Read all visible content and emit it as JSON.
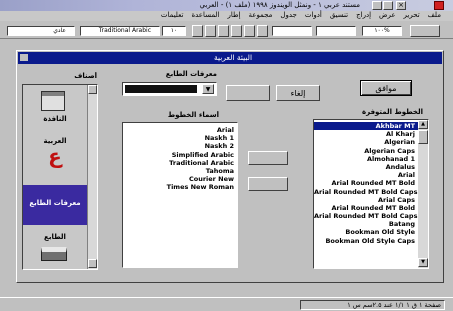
{
  "app": {
    "title": "مستند عربي ١ - ونمثل الويندوز ١٩٩٨ (ملف ١) - العربي",
    "menu": [
      "ملف",
      "تحرير",
      "عرض",
      "إدراج",
      "تنسيق",
      "أدوات",
      "جدول",
      "مجموعة",
      "إطار",
      "المساعدة",
      "تعليمات"
    ]
  },
  "toolbar": {
    "style_value": "عادي",
    "font_value": "Traditional Arabic",
    "size_value": "١٠",
    "zoom_value": "١٠٠%"
  },
  "dialog": {
    "title": "البيئة العربية",
    "sidebar_header": "أصناف",
    "sidebar_items": [
      {
        "label": "النافذة",
        "icon": "window-icon"
      },
      {
        "label": "العربية",
        "icon": "arabic-letter-icon",
        "glyph": "ع"
      },
      {
        "label": "معرفات الطابع",
        "icon": "charset-icon"
      },
      {
        "label": "الطابع",
        "icon": "printer-icon"
      }
    ],
    "selected_sidebar_index": 2,
    "charset_label": "معرفات الطابع",
    "charset_value": "",
    "ok_label": "موافق",
    "cancel_label": "إلغاء",
    "help_label": "",
    "apply_label": "",
    "available_fonts_label": "الخطوط المتوفرة",
    "available_fonts": [
      "Akhbar MT",
      "Al Kharj",
      "Algerian",
      "Algerian Caps",
      "Almohanad 1",
      "Andalus",
      "Arial",
      "Arial Rounded MT Bold",
      "Arial Rounded MT Bold Caps",
      "Arial Caps",
      "Arial Rounded MT Bold",
      "Arial Rounded MT Bold Caps",
      "Batang",
      "Bookman Old Style",
      "Bookman Old Style Caps"
    ],
    "selected_font_index": 0,
    "add_label": "",
    "remove_label": "",
    "chosen_fonts_label": "أسماء الخطوط",
    "chosen_fonts": [
      "Arial",
      "Naskh 1",
      "Naskh 2",
      "Simplified Arabic",
      "Traditional Arabic",
      "Tahoma",
      "Courier New",
      "Times New Roman"
    ]
  },
  "status": {
    "text": "صفحة ١   ق ١   ١/١   عند ٢.٥سم   س ١"
  }
}
